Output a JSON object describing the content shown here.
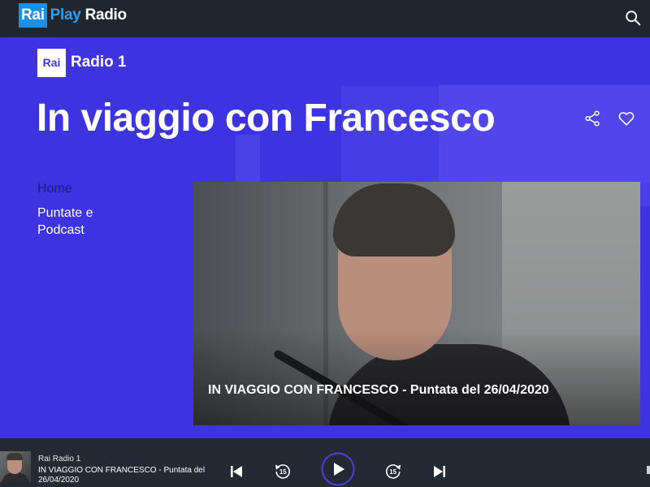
{
  "header": {
    "logo_rai": "Rai",
    "logo_play": "Play",
    "logo_radio": "Radio",
    "search_icon": "search-icon"
  },
  "hero": {
    "channel_rai": "Rai",
    "channel_name": "Radio 1",
    "title": "In viaggio con Francesco",
    "share_icon": "share-icon",
    "favorite_icon": "heart-icon",
    "nav": [
      {
        "label": "Home"
      },
      {
        "label": "Puntate e Podcast"
      }
    ],
    "feature": {
      "caption": "IN VIAGGIO CON FRANCESCO - Puntata del 26/04/2020"
    }
  },
  "player": {
    "channel": "Rai Radio 1",
    "title": "IN VIAGGIO CON FRANCESCO - Puntata del 26/04/2020",
    "rewind_seconds": "15",
    "forward_seconds": "15"
  },
  "colors": {
    "hero_bg": "#3d33e0",
    "topbar_bg": "#1f262e",
    "player_bg": "#232a33",
    "accent_blue": "#27a1ff"
  }
}
